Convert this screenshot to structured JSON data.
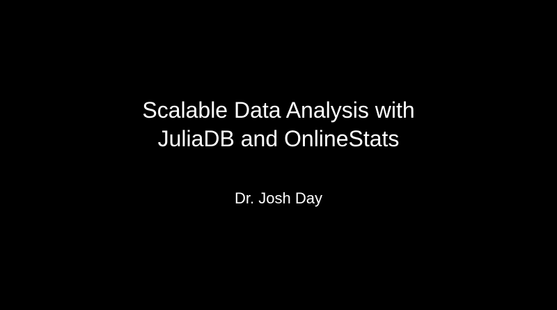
{
  "slide": {
    "title_line_1": "Scalable Data Analysis with",
    "title_line_2": "JuliaDB and OnlineStats",
    "author": "Dr. Josh Day"
  },
  "colors": {
    "background": "#000000",
    "text": "#ffffff"
  }
}
